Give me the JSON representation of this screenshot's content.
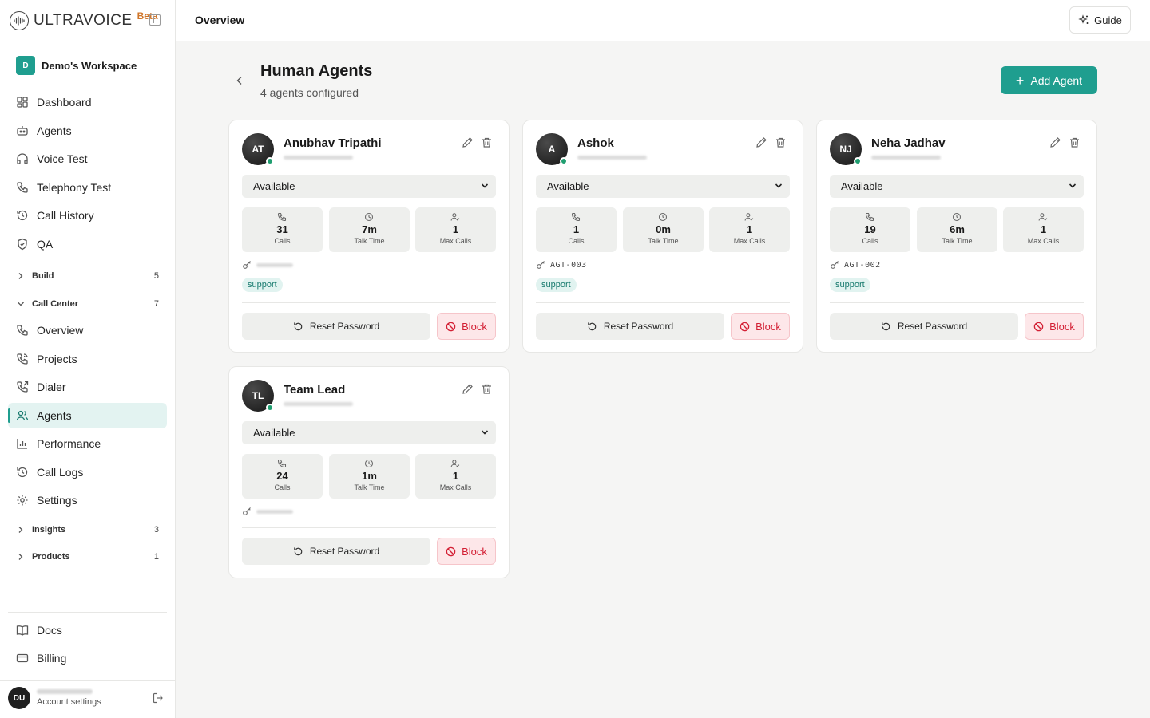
{
  "app": {
    "brand": "ULTRAVOICE",
    "beta_label": "Beta"
  },
  "workspace": {
    "initial": "D",
    "name": "Demo's Workspace"
  },
  "sidebar": {
    "items": [
      {
        "label": "Dashboard",
        "icon": "dashboard-icon"
      },
      {
        "label": "Agents",
        "icon": "bot-icon"
      },
      {
        "label": "Voice Test",
        "icon": "headphones-icon"
      },
      {
        "label": "Telephony Test",
        "icon": "phone-icon"
      },
      {
        "label": "Call History",
        "icon": "history-icon"
      },
      {
        "label": "QA",
        "icon": "shield-check-icon"
      }
    ],
    "groups": [
      {
        "label": "Build",
        "count": "5",
        "expanded": false
      },
      {
        "label": "Call Center",
        "count": "7",
        "expanded": true
      },
      {
        "label": "Insights",
        "count": "3",
        "expanded": false
      },
      {
        "label": "Products",
        "count": "1",
        "expanded": false
      }
    ],
    "call_center_items": [
      {
        "label": "Overview",
        "icon": "phone-icon"
      },
      {
        "label": "Projects",
        "icon": "phone-call-icon"
      },
      {
        "label": "Dialer",
        "icon": "phone-outgoing-icon"
      },
      {
        "label": "Agents",
        "icon": "users-icon",
        "active": true
      },
      {
        "label": "Performance",
        "icon": "bar-chart-icon"
      },
      {
        "label": "Call Logs",
        "icon": "history-icon"
      },
      {
        "label": "Settings",
        "icon": "gear-icon"
      }
    ],
    "footer_items": [
      {
        "label": "Docs",
        "icon": "book-icon"
      },
      {
        "label": "Billing",
        "icon": "credit-card-icon"
      }
    ],
    "account": {
      "initials": "DU",
      "label": "Account settings"
    }
  },
  "header": {
    "title": "Overview",
    "guide_label": "Guide"
  },
  "page": {
    "title": "Human Agents",
    "subtitle": "4 agents configured",
    "add_button": "Add Agent"
  },
  "stat_labels": {
    "calls": "Calls",
    "talk_time": "Talk Time",
    "max_calls": "Max Calls"
  },
  "actions": {
    "reset_password": "Reset Password",
    "block": "Block"
  },
  "agents": [
    {
      "initials": "AT",
      "name": "Anubhav Tripathi",
      "status": "Available",
      "calls": "31",
      "talk_time": "7m",
      "max_calls": "1",
      "agent_id": "",
      "tag": "support"
    },
    {
      "initials": "A",
      "name": "Ashok",
      "status": "Available",
      "calls": "1",
      "talk_time": "0m",
      "max_calls": "1",
      "agent_id": "AGT-003",
      "tag": "support"
    },
    {
      "initials": "NJ",
      "name": "Neha Jadhav",
      "status": "Available",
      "calls": "19",
      "talk_time": "6m",
      "max_calls": "1",
      "agent_id": "AGT-002",
      "tag": "support"
    },
    {
      "initials": "TL",
      "name": "Team Lead",
      "status": "Available",
      "calls": "24",
      "talk_time": "1m",
      "max_calls": "1",
      "agent_id": "",
      "tag": ""
    }
  ],
  "colors": {
    "accent": "#1f9e8f",
    "online": "#1f9e70",
    "danger": "#d31f34",
    "beta": "#d0762a"
  }
}
